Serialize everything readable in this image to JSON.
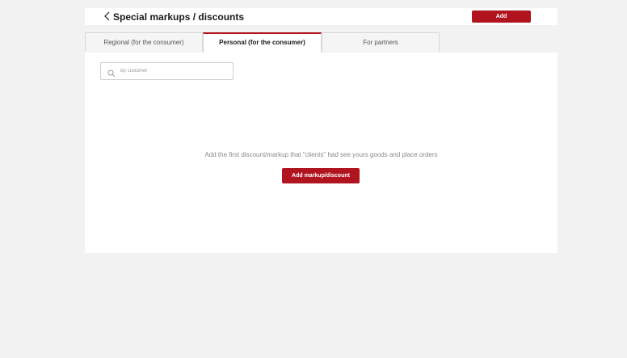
{
  "header": {
    "title": "Special markups / discounts",
    "add_label": "Add"
  },
  "tabs": [
    {
      "label": "Regional (for the consumer)",
      "active": false
    },
    {
      "label": "Personal (for the consumer)",
      "active": true
    },
    {
      "label": "For partners",
      "active": false
    }
  ],
  "search": {
    "placeholder": "By customer",
    "value": ""
  },
  "empty_state": {
    "message": "Add the first discount/markup that \"clients\" had see yours goods and place orders",
    "button_label": "Add markup/discount"
  },
  "colors": {
    "accent": "#b0141e",
    "background": "#f2f2f2",
    "panel": "#ffffff"
  },
  "icons": [
    "chevron-left-icon",
    "search-icon"
  ]
}
